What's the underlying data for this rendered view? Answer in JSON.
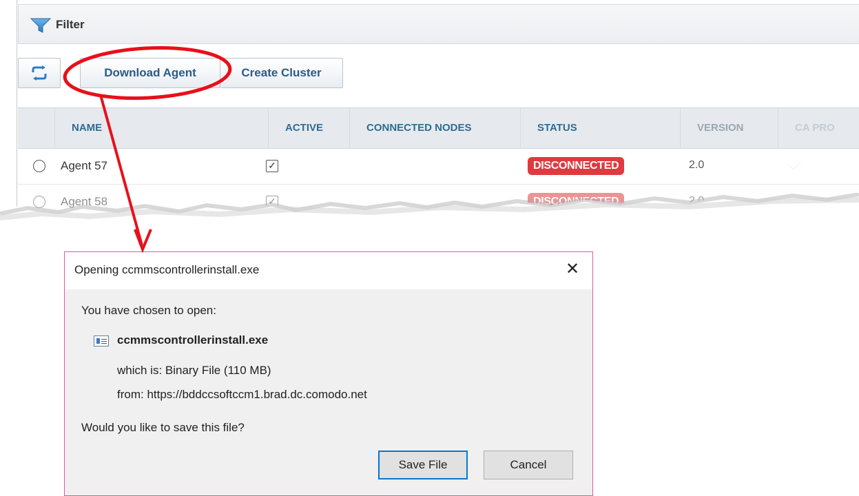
{
  "app": {
    "filter_label": "Filter",
    "toolbar": {
      "download_agent": "Download Agent",
      "create_cluster": "Create Cluster"
    },
    "table": {
      "columns": [
        "NAME",
        "ACTIVE",
        "CONNECTED NODES",
        "STATUS",
        "VERSION",
        "CA PRO"
      ],
      "rows": [
        {
          "name": "Agent 57",
          "active": true,
          "connected_nodes": "",
          "status": "DISCONNECTED",
          "version": "2.0"
        },
        {
          "name": "Agent 58",
          "active": true,
          "connected_nodes": "",
          "status": "DISCONNECTED",
          "version": "2.0"
        }
      ]
    }
  },
  "dialog": {
    "title": "Opening ccmmscontrollerinstall.exe",
    "close_glyph": "✕",
    "chosen_text": "You have chosen to open:",
    "filename": "ccmmscontrollerinstall.exe",
    "which_is": "which is:  Binary File (110 MB)",
    "from": "from:  https://bddccsoftccm1.brad.dc.comodo.net",
    "question": "Would you like to save this file?",
    "save_label": "Save File",
    "cancel_label": "Cancel"
  },
  "colors": {
    "annotation_red": "#e8101b",
    "status_red": "#df3a3f",
    "header_text": "#2f6b95",
    "dialog_border": "#e0589a",
    "default_button_border": "#0078d7"
  }
}
